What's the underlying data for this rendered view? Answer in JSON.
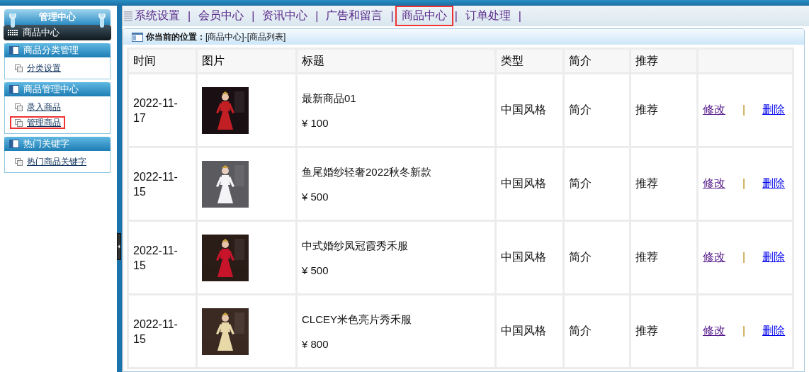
{
  "sidebar": {
    "title": "管理中心",
    "section": "商品中心",
    "groups": [
      {
        "title": "商品分类管理",
        "items": [
          {
            "label": "分类设置",
            "selected": false
          }
        ]
      },
      {
        "title": "商品管理中心",
        "items": [
          {
            "label": "录入商品",
            "selected": false
          },
          {
            "label": "管理商品",
            "selected": true
          }
        ]
      },
      {
        "title": "热门关键字",
        "items": [
          {
            "label": "热门商品关键字",
            "selected": false
          }
        ]
      }
    ]
  },
  "nav": [
    {
      "label": "系统设置",
      "separator": "|",
      "selected": false
    },
    {
      "label": "会员中心",
      "separator": "|",
      "selected": false
    },
    {
      "label": "资讯中心",
      "separator": "|",
      "selected": false
    },
    {
      "label": "广告和留言",
      "separator": "|",
      "selected": false
    },
    {
      "label": "商品中心",
      "separator": "|",
      "selected": true
    },
    {
      "label": "订单处理",
      "separator": "|",
      "selected": false
    }
  ],
  "breadcrumb": "**你当前的位置：**[商品中心]-[商品列表]",
  "table": {
    "columns": [
      "时间",
      "图片",
      "标题",
      "类型",
      "简介",
      "推荐"
    ],
    "rows": [
      {
        "time": "2022-11-17",
        "title": "最新商品01",
        "price": "¥ 100",
        "type": "中国风格",
        "intro": "简介",
        "recommend": "推荐",
        "edit": "修改",
        "separator": "|",
        "delete": "删除"
      },
      {
        "time": "2022-11-15",
        "title": "鱼尾婚纱轻奢2022秋冬新款",
        "price": "¥ 500",
        "type": "中国风格",
        "intro": "简介",
        "recommend": "推荐",
        "edit": "修改",
        "separator": "|",
        "delete": "删除"
      },
      {
        "time": "2022-11-15",
        "title": "中式婚纱凤冠霞秀禾服",
        "price": "¥ 500",
        "type": "中国风格",
        "intro": "简介",
        "recommend": "推荐",
        "edit": "修改",
        "separator": "|",
        "delete": "删除"
      },
      {
        "time": "2022-11-15",
        "title": "CLCEY米色亮片秀禾服",
        "price": "¥ 800",
        "type": "中国风格",
        "intro": "简介",
        "recommend": "推荐",
        "edit": "修改",
        "separator": "|",
        "delete": "删除"
      }
    ]
  }
}
